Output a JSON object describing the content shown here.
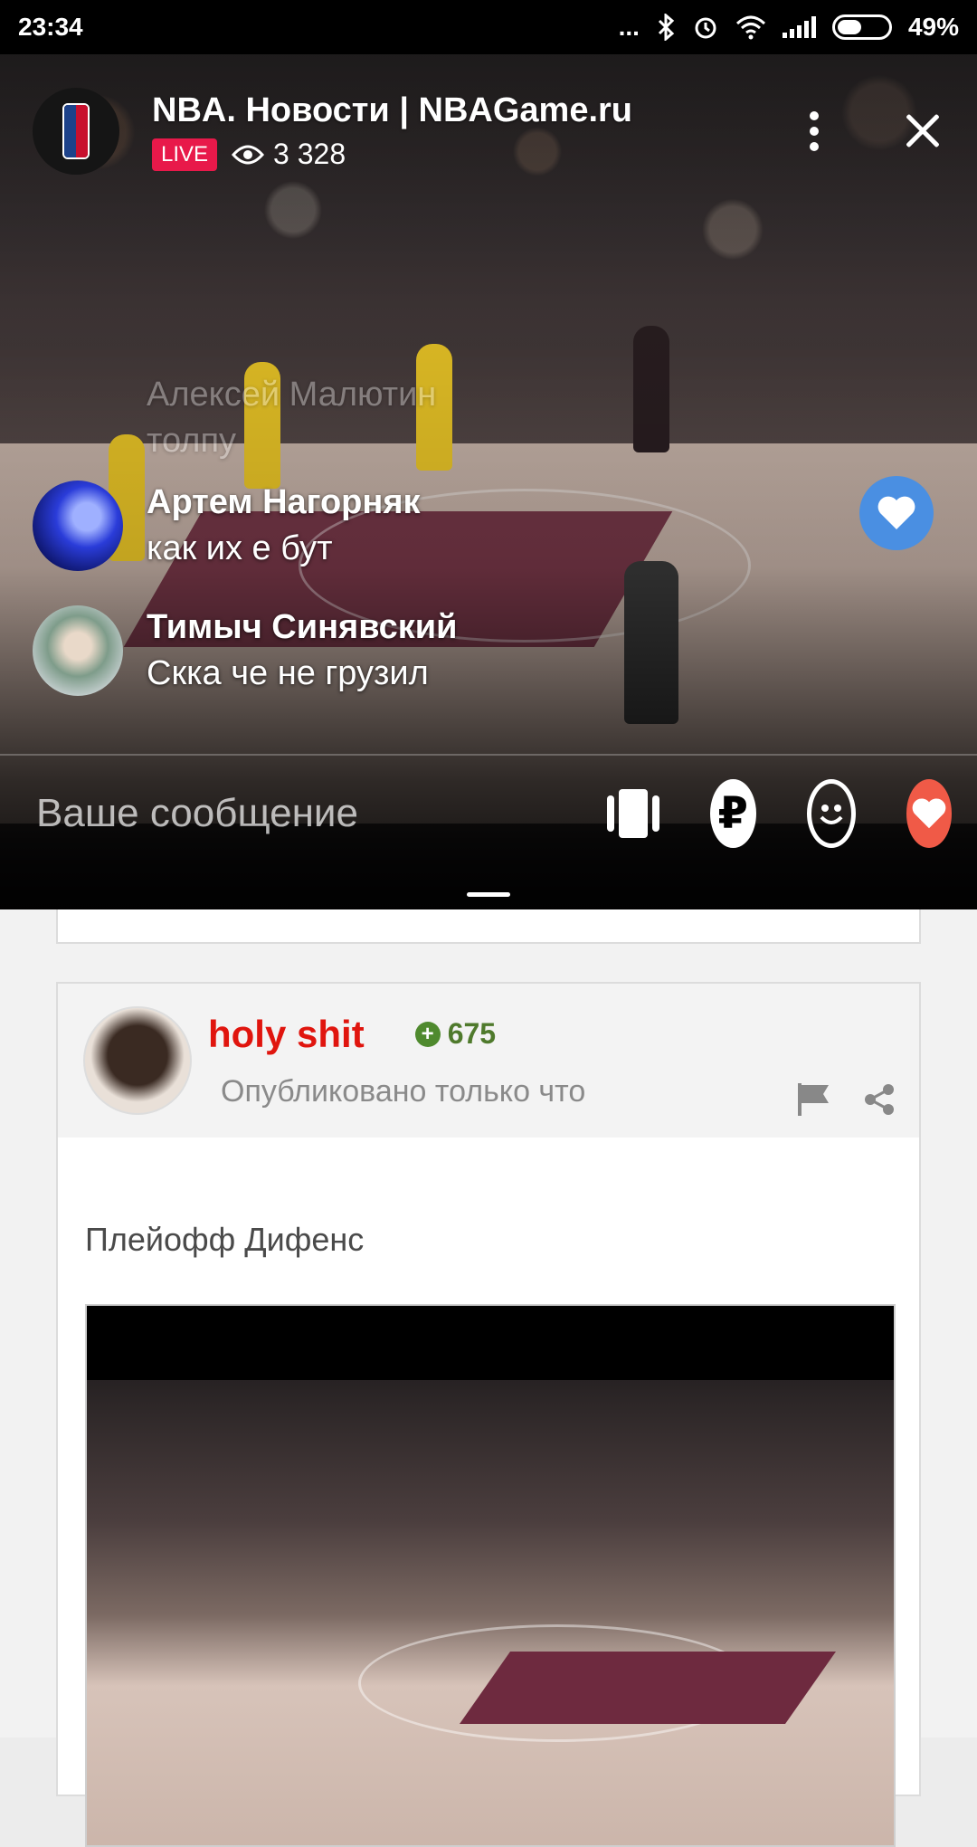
{
  "status_bar": {
    "time": "23:34",
    "dots": "...",
    "battery": "49%",
    "battery_level": 0.49
  },
  "stream": {
    "channel_title": "NBA. Новости | NBAGame.ru",
    "live_label": "LIVE",
    "viewers": "3 328",
    "comments": [
      {
        "name": "Алексей Малютин",
        "text": "толпу",
        "faded": true
      },
      {
        "name": "Артем Нагорняк",
        "text": "как их е бут"
      },
      {
        "name": "Тимыч Синявский",
        "text": "Скка че не грузил"
      }
    ],
    "input_placeholder": "Ваше сообщение",
    "donate_symbol": "₽",
    "colors": {
      "live": "#e8194a",
      "like_float": "#4a8fe2",
      "heart_button": "#f05a47"
    }
  },
  "post": {
    "author": "holy shit",
    "rating_sign": "+",
    "rating": "675",
    "published": "Опубликовано только что",
    "text": "Плейофф Дифенс",
    "colors": {
      "author": "#e0150e",
      "rating": "#4f7a2c"
    }
  }
}
